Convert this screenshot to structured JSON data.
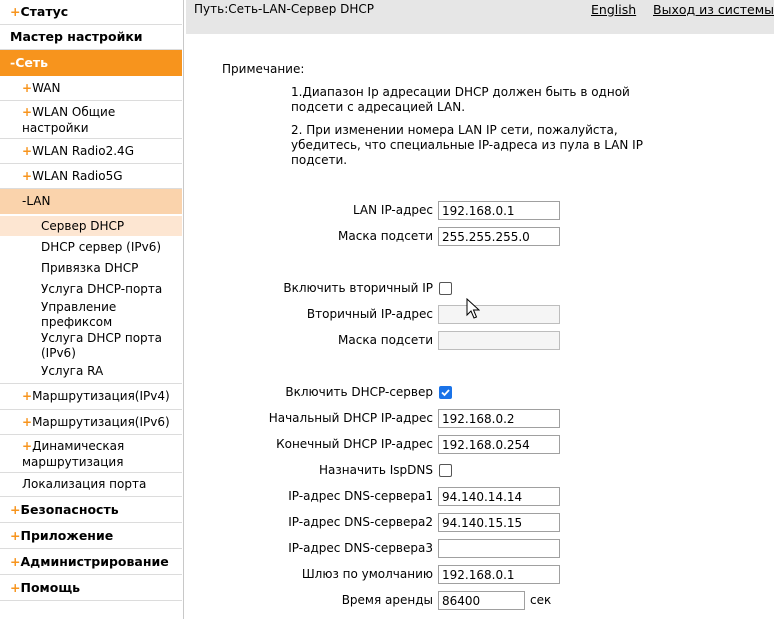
{
  "sidebar": {
    "items": [
      {
        "label": "Статус",
        "type": "top"
      },
      {
        "label": "Мастер настройки",
        "type": "top"
      },
      {
        "label": "Сеть",
        "type": "top"
      },
      {
        "label": "WAN",
        "type": "sub"
      },
      {
        "label": "WLAN Общие",
        "label2": "настройки",
        "type": "sub"
      },
      {
        "label": "WLAN Radio2.4G",
        "type": "sub"
      },
      {
        "label": "WLAN Radio5G",
        "type": "sub"
      },
      {
        "label": "LAN",
        "type": "sub"
      },
      {
        "label": "Сервер DHCP",
        "type": "leaf"
      },
      {
        "label": "DHCP сервер (IPv6)",
        "type": "leaf"
      },
      {
        "label": "Привязка DHCP",
        "type": "leaf"
      },
      {
        "label": "Услуга DHCP-порта",
        "type": "leaf"
      },
      {
        "label": "Управление",
        "label2": "префиксом",
        "type": "leaf"
      },
      {
        "label": "Услуга DHCP порта",
        "label2": "(IPv6)",
        "type": "leaf"
      },
      {
        "label": "Услуга RA",
        "type": "leaf"
      },
      {
        "label": "Маршрутизация(IPv4)",
        "type": "sub"
      },
      {
        "label": "Маршрутизация(IPv6)",
        "type": "sub"
      },
      {
        "label": "Динамическая",
        "label2": "маршрутизация",
        "type": "sub"
      },
      {
        "label": "Локализация порта",
        "type": "sub"
      },
      {
        "label": "Безопасность",
        "type": "top"
      },
      {
        "label": "Приложение",
        "type": "top"
      },
      {
        "label": "Администрирование",
        "type": "top"
      },
      {
        "label": "Помощь",
        "type": "top"
      }
    ],
    "plus": "+",
    "minus": "-"
  },
  "header": {
    "path": "Путь:Сеть-LAN-Сервер DHCP",
    "english": "English",
    "logout": "Выход из системы"
  },
  "note": {
    "title": "Примечание:",
    "line1": "1.Диапазон Ip адресации DHCP должен быть в одной подсети с адресацией LAN.",
    "line2": "2. При изменении номера LAN IP сети, пожалуйста, убедитесь, что специальные IP-адреса из пула в LAN IP подсети."
  },
  "form": {
    "lan_ip_label": "LAN IP-адрес",
    "lan_ip": "192.168.0.1",
    "mask_label": "Маска подсети",
    "mask": "255.255.255.0",
    "secondary_enable_label": "Включить вторичный IP",
    "secondary_enable": false,
    "secondary_ip_label": "Вторичный IP-адрес",
    "secondary_ip": "",
    "secondary_mask_label": "Маска подсети",
    "secondary_mask": "",
    "dhcp_enable_label": "Включить DHCP-сервер",
    "dhcp_enable": true,
    "start_ip_label": "Начальный DHCP IP-адрес",
    "start_ip": "192.168.0.2",
    "end_ip_label": "Конечный DHCP IP-адрес",
    "end_ip": "192.168.0.254",
    "isp_dns_label": "Назначить IspDNS",
    "isp_dns": false,
    "dns1_label": "IP-адрес DNS-сервера1",
    "dns1": "94.140.14.14",
    "dns2_label": "IP-адрес DNS-сервера2",
    "dns2": "94.140.15.15",
    "dns3_label": "IP-адрес DNS-сервера3",
    "dns3": "",
    "gateway_label": "Шлюз по умолчанию",
    "gateway": "192.168.0.1",
    "lease_label": "Время аренды",
    "lease": "86400",
    "lease_unit": "сек"
  },
  "colors": {
    "accent": "#f7941d",
    "selected_sub": "#fad3ac",
    "selected_leaf": "#fde6d2",
    "checkbox": "#1a73e8"
  }
}
